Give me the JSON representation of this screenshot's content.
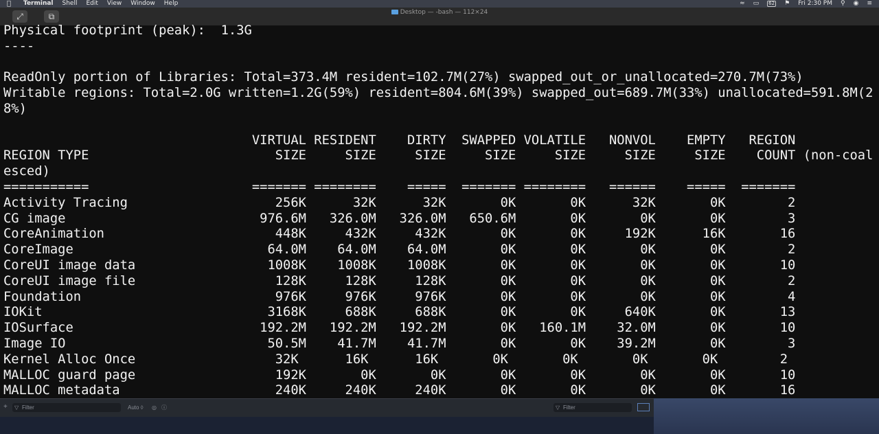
{
  "menubar": {
    "apple": "",
    "items": [
      "Terminal",
      "Shell",
      "Edit",
      "View",
      "Window",
      "Help"
    ],
    "clock": "Fri 2:30 PM",
    "battery": "62"
  },
  "window": {
    "title": "Desktop — -bash — 112×24"
  },
  "terminal": {
    "lines": [
      "Physical footprint (peak):  1.3G",
      "----",
      "",
      "ReadOnly portion of Libraries: Total=373.4M resident=102.7M(27%) swapped_out_or_unallocated=270.7M(73%)",
      "Writable regions: Total=2.0G written=1.2G(59%) resident=804.6M(39%) swapped_out=689.7M(33%) unallocated=591.8M(2",
      "8%)",
      "",
      "                                VIRTUAL RESIDENT    DIRTY  SWAPPED VOLATILE   NONVOL    EMPTY   REGION",
      "REGION TYPE                        SIZE     SIZE     SIZE     SIZE     SIZE     SIZE     SIZE    COUNT (non-coal",
      "esced)",
      "===========                     ======= ========    =====  ======= ========   ======    =====  =======",
      "Activity Tracing                   256K      32K      32K       0K       0K      32K       0K        2",
      "CG image                         976.6M   326.0M   326.0M   650.6M       0K       0K       0K        3",
      "CoreAnimation                      448K     432K     432K       0K       0K     192K      16K       16",
      "CoreImage                         64.0M    64.0M    64.0M       0K       0K       0K       0K        2",
      "CoreUI image data                 1008K    1008K    1008K       0K       0K       0K       0K       10",
      "CoreUI image file                  128K     128K     128K       0K       0K       0K       0K        2",
      "Foundation                         976K     976K     976K       0K       0K       0K       0K        4",
      "IOKit                             3168K     688K     688K       0K       0K     640K       0K       13",
      "IOSurface                        192.2M   192.2M   192.2M       0K   160.1M    32.0M       0K       10",
      "Image IO                          50.5M    41.7M    41.7M       0K       0K    39.2M       0K        3",
      "Kernel Alloc Once                  32K      16K      16K       0K       0K       0K       0K        2",
      "MALLOC guard page                  192K       0K       0K       0K       0K       0K       0K       10",
      "MALLOC metadata                    240K     240K     240K       0K       0K       0K       0K       16"
    ]
  },
  "bottombar": {
    "filter_left_placeholder": "Filter",
    "auto_label": "Auto ◊",
    "filter_right_placeholder": "Filter"
  }
}
